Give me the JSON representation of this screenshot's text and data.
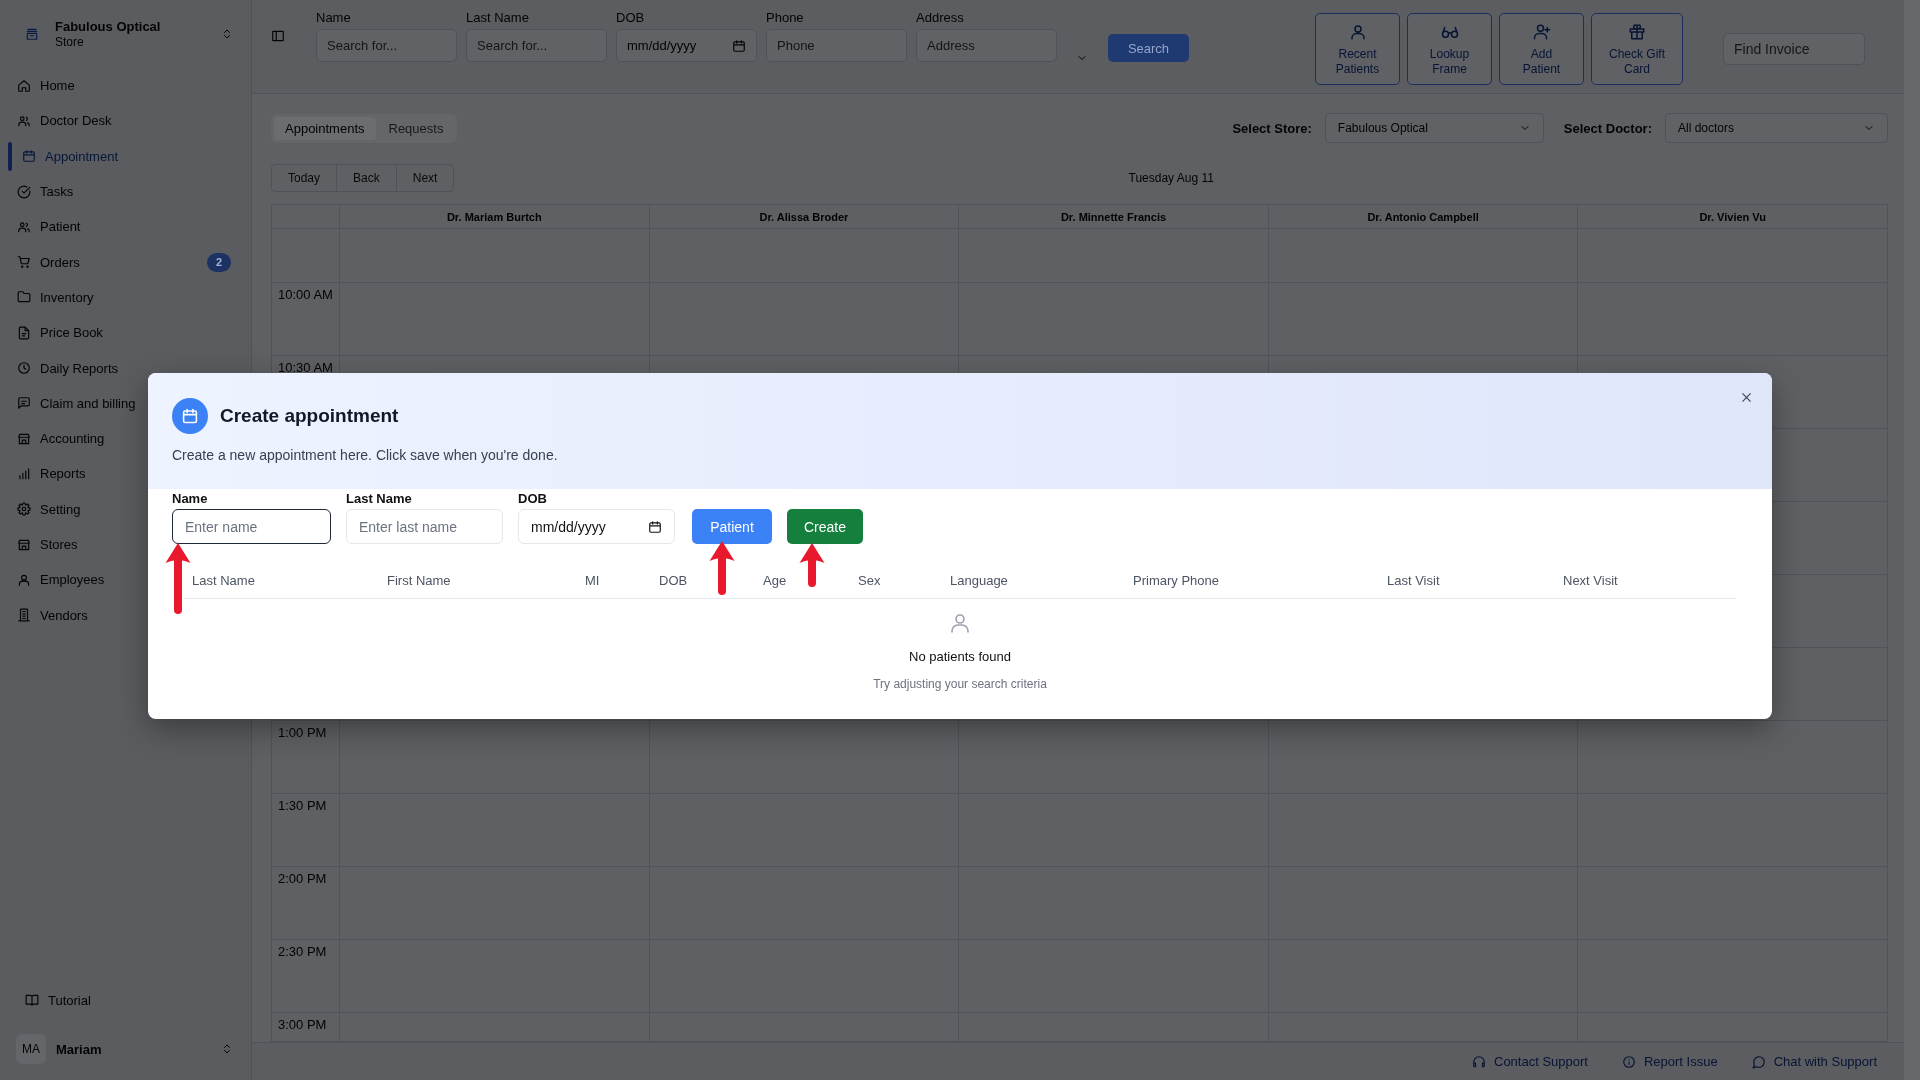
{
  "sidebar": {
    "store": {
      "name": "Fabulous Optical",
      "subtitle": "Store"
    },
    "items": [
      {
        "label": "Home",
        "selected": false
      },
      {
        "label": "Doctor Desk",
        "selected": false
      },
      {
        "label": "Appointment",
        "selected": true
      },
      {
        "label": "Tasks",
        "selected": false
      },
      {
        "label": "Patient",
        "selected": false
      },
      {
        "label": "Orders",
        "selected": false,
        "badge": "2"
      },
      {
        "label": "Inventory",
        "selected": false
      },
      {
        "label": "Price Book",
        "selected": false
      },
      {
        "label": "Daily Reports",
        "selected": false
      },
      {
        "label": "Claim and billing",
        "selected": false
      },
      {
        "label": "Accounting",
        "selected": false
      },
      {
        "label": "Reports",
        "selected": false
      },
      {
        "label": "Setting",
        "selected": false
      },
      {
        "label": "Stores",
        "selected": false
      },
      {
        "label": "Employees",
        "selected": false
      },
      {
        "label": "Vendors",
        "selected": false
      }
    ],
    "tutorial": "Tutorial",
    "user": {
      "initials": "MA",
      "name": "Mariam"
    }
  },
  "search_bar": {
    "fields": [
      {
        "label": "Name",
        "placeholder": "Search for...",
        "kind": "text"
      },
      {
        "label": "Last Name",
        "placeholder": "Search for...",
        "kind": "text"
      },
      {
        "label": "DOB",
        "placeholder": "mm/dd/yyyy",
        "kind": "date"
      },
      {
        "label": "Phone",
        "placeholder": "Phone",
        "kind": "text"
      },
      {
        "label": "Address",
        "placeholder": "Address",
        "kind": "text"
      }
    ],
    "search_button": "Search"
  },
  "quick_actions": [
    "Recent Patients",
    "Lookup Frame",
    "Add Patient",
    "Check Gift Card"
  ],
  "find_invoice": {
    "placeholder": "Find Invoice"
  },
  "tabs": [
    {
      "label": "Appointments",
      "selected": true
    },
    {
      "label": "Requests",
      "selected": false
    }
  ],
  "filters": [
    {
      "label": "Select Store:",
      "value": "Fabulous Optical"
    },
    {
      "label": "Select Doctor:",
      "value": "All doctors"
    }
  ],
  "calendar_nav": [
    "Today",
    "Back",
    "Next"
  ],
  "date_title": "Tuesday Aug 11",
  "calendar": {
    "doctors": [
      "Dr. Mariam Burtch",
      "Dr. Alissa Broder",
      "Dr. Minnette Francis",
      "Dr. Antonio Campbell",
      "Dr. Vivien Vu"
    ],
    "times_above_dialog": [
      "10:00 AM",
      "10:30 AM"
    ],
    "times_below_dialog": [
      "1:00 PM",
      "1:30 PM",
      "2:00 PM",
      "2:30 PM",
      "3:00 PM"
    ]
  },
  "modal": {
    "title": "Create appointment",
    "description": "Create a new appointment here. Click save when you're done.",
    "fields": [
      {
        "label": "Name",
        "placeholder": "Enter name",
        "kind": "text",
        "focused": true
      },
      {
        "label": "Last Name",
        "placeholder": "Enter last name",
        "kind": "text",
        "focused": false
      },
      {
        "label": "DOB",
        "placeholder": "mm/dd/yyyy",
        "kind": "date",
        "focused": false
      }
    ],
    "buttons": [
      {
        "label": "Patient",
        "kind": "primary"
      },
      {
        "label": "Create",
        "kind": "success"
      }
    ],
    "table": {
      "columns": [
        "Last Name",
        "First Name",
        "MI",
        "DOB",
        "Age",
        "Sex",
        "Language",
        "Primary Phone",
        "Last Visit",
        "Next Visit"
      ]
    },
    "empty_state": {
      "title": "No patients found",
      "hint": "Try adjusting your search criteria"
    }
  },
  "footer": [
    "Contact Support",
    "Report Issue",
    "Chat with Support"
  ]
}
